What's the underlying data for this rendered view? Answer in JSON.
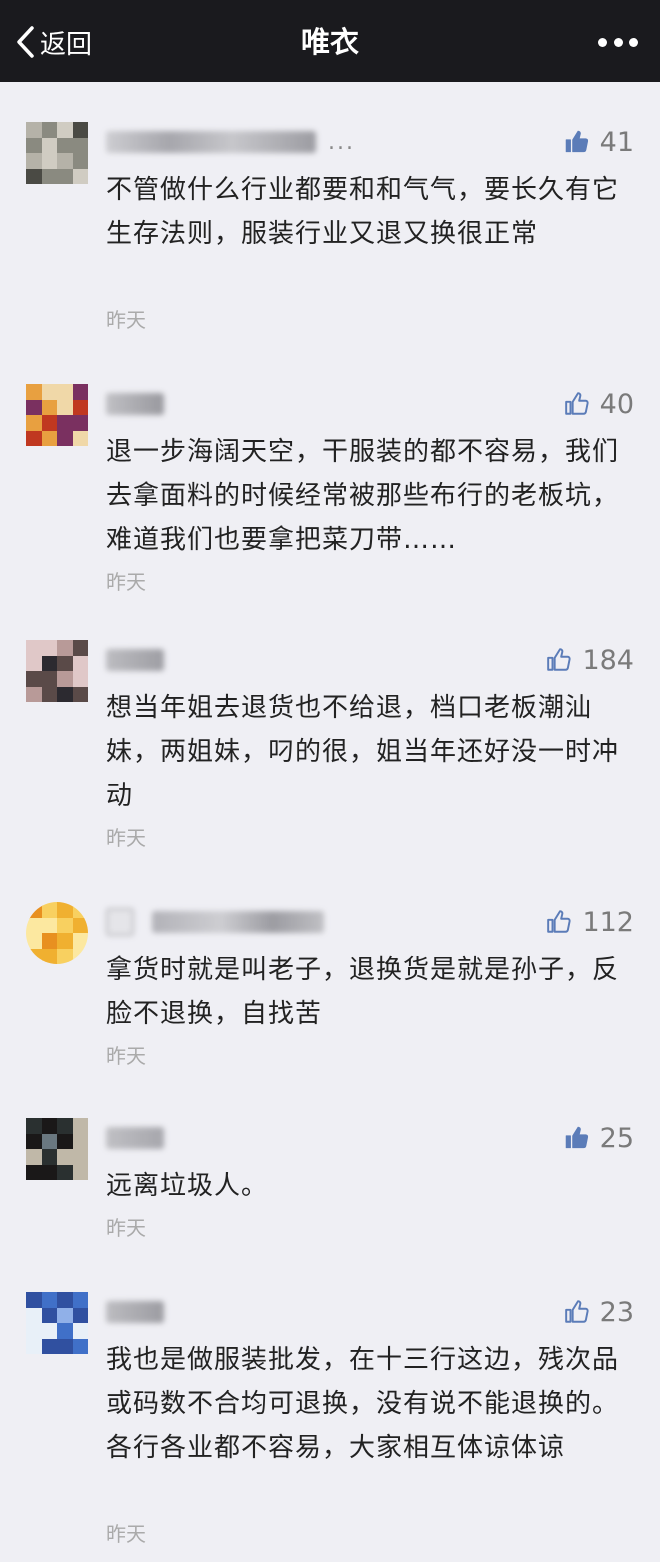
{
  "nav": {
    "back_label": "返回",
    "title": "唯衣"
  },
  "comments": [
    {
      "likes": "41",
      "text": "不管做什么行业都要和和气气，要长久有它生存法则，服装行业又退又换很正常",
      "time": "昨天",
      "name_suffix": "..."
    },
    {
      "likes": "40",
      "text": "退一步海阔天空，干服装的都不容易，我们去拿面料的时候经常被那些布行的老板坑，难道我们也要拿把菜刀带……",
      "time": "昨天"
    },
    {
      "likes": "184",
      "text": "想当年姐去退货也不给退，档口老板潮汕妹，两姐妹，叼的很，姐当年还好没一时冲动",
      "time": "昨天"
    },
    {
      "likes": "112",
      "text": "拿货时就是叫老子，退换货是就是孙子，反脸不退换，自找苦",
      "time": "昨天"
    },
    {
      "likes": "25",
      "text": "远离垃圾人。",
      "time": "昨天"
    },
    {
      "likes": "23",
      "text": "我也是做服装批发，在十三行这边，残次品或码数不合均可退换，没有说不能退换的。各行各业都不容易，大家相互体谅体谅",
      "time": "昨天"
    }
  ],
  "colors": {
    "navbar": "#1a1a1e",
    "background": "#efeff4",
    "like_icon": "#5b7cb8",
    "avatar_palettes": [
      [
        "#8a8a80",
        "#b5b2a8",
        "#4a4a44",
        "#d0ccc2"
      ],
      [
        "#e8a040",
        "#c03820",
        "#f0d8a8",
        "#7a3060"
      ],
      [
        "#5a4a48",
        "#b89a98",
        "#2c2a30",
        "#e0c8c8"
      ],
      [
        "#f0b030",
        "#f8d060",
        "#e89020",
        "#fce8a0"
      ],
      [
        "#2a3030",
        "#6a7880",
        "#c0b8a8",
        "#1a1818"
      ],
      [
        "#4070c8",
        "#90b0e8",
        "#e8f0f8",
        "#3050a0"
      ]
    ]
  },
  "icons": {
    "back": "chevron-left-icon",
    "more": "more-dots-icon",
    "like": "thumbs-up-icon"
  }
}
